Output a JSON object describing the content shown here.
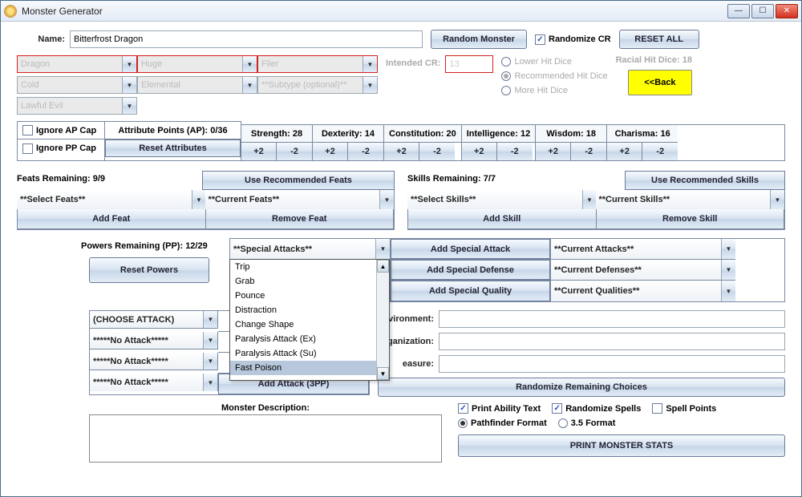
{
  "window": {
    "title": "Monster Generator"
  },
  "top": {
    "name_label": "Name:",
    "name_value": "Bitterfrost Dragon",
    "random_btn": "Random Monster",
    "randomize_cr_cb": "Randomize CR",
    "reset_all_btn": "RESET ALL"
  },
  "types": {
    "type": "Dragon",
    "size": "Huge",
    "movement": "Flier",
    "element": "Cold",
    "category": "Elemental",
    "subtype": "**Subtype (optional)**",
    "alignment": "Lawful Evil"
  },
  "cr": {
    "label": "Intended CR:",
    "value": "13",
    "opt_lower": "Lower Hit Dice",
    "opt_rec": "Recommended Hit Dice",
    "opt_more": "More Hit Dice",
    "racial_hd": "Racial Hit Dice: 18",
    "back": "<<Back"
  },
  "attributes": {
    "ignore_ap": "Ignore AP Cap",
    "ignore_pp": "Ignore PP Cap",
    "ap_label": "Attribute Points (AP): 0/36",
    "reset_btn": "Reset Attributes",
    "stats": [
      {
        "name": "Strength: 28"
      },
      {
        "name": "Dexterity: 14"
      },
      {
        "name": "Constitution: 20"
      },
      {
        "name": "Intelligence: 12"
      },
      {
        "name": "Wisdom: 18"
      },
      {
        "name": "Charisma: 16"
      }
    ],
    "plus": "+2",
    "minus": "-2"
  },
  "feats": {
    "remaining": "Feats Remaining: 9/9",
    "rec_btn": "Use Recommended Feats",
    "select": "**Select Feats**",
    "current": "**Current Feats**",
    "add": "Add Feat",
    "remove": "Remove Feat"
  },
  "skills": {
    "remaining": "Skills Remaining: 7/7",
    "rec_btn": "Use Recommended Skills",
    "select": "**Select Skills**",
    "current": "**Current Skills**",
    "add": "Add Skill",
    "remove": "Remove Skill"
  },
  "powers": {
    "remaining": "Powers Remaining (PP): 12/29",
    "reset": "Reset Powers",
    "special_attacks": "**Special Attacks**",
    "add_atk": "Add Special Attack",
    "add_def": "Add Special Defense",
    "add_qual": "Add Special Quality",
    "curr_atk": "**Current Attacks**",
    "curr_def": "**Current Defenses**",
    "curr_qual": "**Current Qualities**",
    "dropdown_items": [
      "Trip",
      "Grab",
      "Pounce",
      "Distraction",
      "Change Shape",
      "Paralysis Attack (Ex)",
      "Paralysis Attack (Su)",
      "Fast Poison"
    ]
  },
  "attacks": {
    "choose": "(CHOOSE ATTACK)",
    "none": "*****No Attack*****",
    "add_attack": "Add Attack (3PP)"
  },
  "info": {
    "env_lbl": "vironment:",
    "org_lbl": "ganization:",
    "treasure_lbl": "easure:",
    "randomize_remaining": "Randomize Remaining Choices",
    "desc_lbl": "Monster Description:"
  },
  "print": {
    "cb1": "Print Ability Text",
    "cb2": "Randomize Spells",
    "cb3": "Spell Points",
    "radio1": "Pathfinder Format",
    "radio2": "3.5 Format",
    "btn": "PRINT MONSTER STATS"
  }
}
